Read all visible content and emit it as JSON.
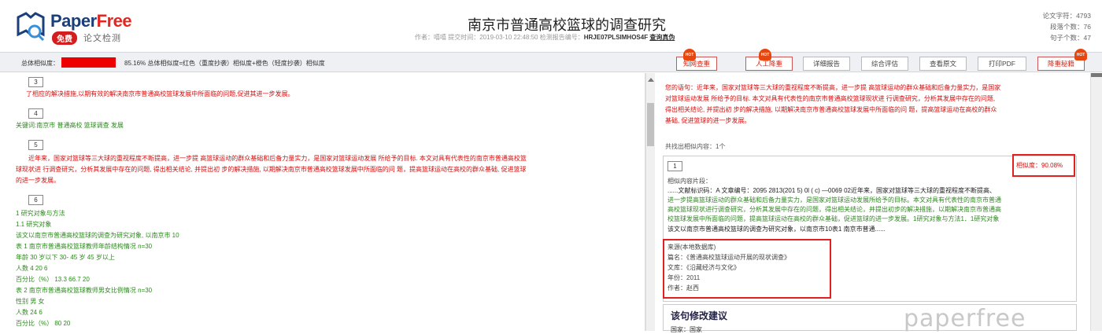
{
  "header": {
    "brand_paper": "Paper",
    "brand_free": "Free",
    "free_badge": "免费",
    "subtitle": "论文检测",
    "title": "南京市普通高校篮球的调查研究",
    "meta_prefix": "作者：嘻嘻  提交时间：2019-03-10 22:48:50  检测报告编号：",
    "report_no": "HRJE07PLSIMHOS4F",
    "verify": "查询真伪",
    "stats": [
      "论文字符：4793",
      "段落个数：76",
      "句子个数：47"
    ]
  },
  "toolbar": {
    "label": "总体相似度：",
    "similarity_percent": 85.16,
    "summary": "85.16%  总体相似度=红色（重度抄袭）相似度+橙色（轻度抄袭）相似度",
    "buttons": [
      "知网查重",
      "人工降重",
      "详细报告",
      "综合评估",
      "查看原文",
      "打印PDF",
      "降重秘籍"
    ],
    "hot": "HOT"
  },
  "left": {
    "p3_num": "3",
    "p3_text": "了相应的解决措施,以期有效的解决南京市普通高校篮球发展中所面临的问题,促进其进一步发展。",
    "p4_num": "4",
    "p4_text": "关键词:南京市 普通高校 篮球调查 发展",
    "p5_num": "5",
    "p5_lines": [
      "近年来，国家对篮球等三大球的重视程度不断提高，进一步提 高篮球运动的群众基础和后备力量实力，是国家对篮球运动发展 所给予的目标. 本文对具有代表性的南京市普通高校篮",
      "球现状进 行调查研究，分析其发展中存在的问题, 得出相关结论, 并提出初 步的解决措施, 以期解决南京市普通高校篮球发展中所面临的问 题，提高篮球运动在高校的群众基础, 促进篮球",
      "的进一步发展。"
    ],
    "p6_num": "6",
    "p6_lines": [
      "1 研究对象与方法",
      "1.1 研究对象",
      "该文以南京市普通高校篮球的调查为研究对象, 以南京市 10",
      "表 1 南京市普通高校篮球教师年龄结构情况 n=30",
      "年龄 30 岁以下 30- 45 岁 45 岁以上",
      "人数 4 20 6",
      "百分比（%） 13.3 66.7 20",
      "表 2 南京市普通高校篮球教师男女比例情况 n=30",
      "性别 男 女",
      "人数 24 6",
      "百分比（%） 80 20"
    ]
  },
  "right": {
    "sentence_lines": [
      "您的语句：近年来，国家对篮球等三大球的重视程度不断提高，进一步提 高篮球运动的群众基础和后备力量实力，是国家",
      "对篮球运动发展 所给予的目标. 本文对具有代表性的南京市普通高校篮球现状进 行调查研究，分析其发展中存在的问题,",
      "得出相关结论, 并提出初 步的解决措施, 以期解决南京市普通高校篮球发展中所面临的问 题，提高篮球运动在高校的群众",
      "基础, 促进篮球的进一步发展。"
    ],
    "found": "共找出相似内容：1个",
    "card_num": "1",
    "similarity": "相似度：90.08%",
    "fragment_label": "相似内容片段：",
    "fragment_lines": [
      "......文献标识码：A 文章编号：2095 2813(201 5) 0l ( c) —0069 02近年来，国家对篮球等三大球的重视程度不断提高、",
      "进一步提高篮球运动的群众基础和后备力量实力，是国家对篮球运动发展所给予的目标。本文对具有代表性的南京市普通",
      "高校篮球现状进行调查研究，分析其发展中存在的问题，得出相关结论，并提出初步的解决措施，以期解决南京市普通高",
      "校篮球发展中所面临的问题，提高篮球运动在高校的群众基础，促进篮球的进一步发展。1研究对象与方法1．1研究对象",
      "该文以南京市普通高校篮球的调查为研究对象，以南京市10表1 南京市普通......"
    ],
    "source_lines": [
      "来源(本地数据库)",
      "篇名：《普通高校篮球运动开展的现状调查》",
      "文库：《沿藏经济与文化》",
      "年份：2011",
      "作者：赵西"
    ],
    "suggestion_title": "该句修改建议",
    "suggestion_sub": "国家：国家",
    "watermark": "paperfree"
  },
  "colors": {
    "red": "#d40f0f",
    "green": "#2d8a1e",
    "navy": "#1a3f7a"
  }
}
